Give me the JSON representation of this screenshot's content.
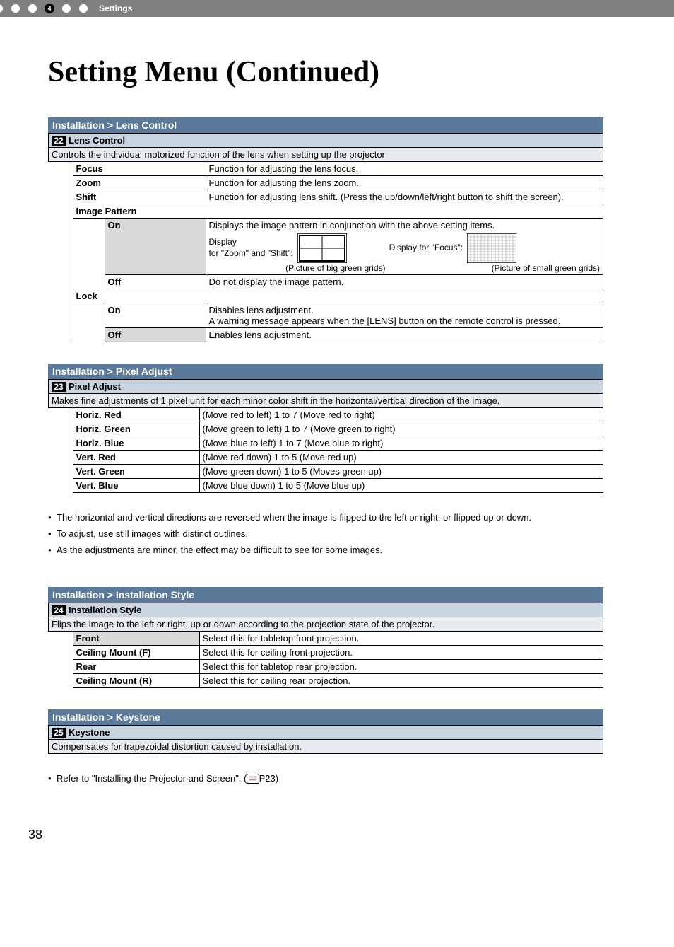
{
  "header": {
    "step_active": "4",
    "label": "Settings"
  },
  "page_title": "Setting Menu (Continued)",
  "page_number": "38",
  "sections": {
    "lens_control": {
      "breadcrumb": "Installation > Lens Control",
      "num": "22",
      "title": "Lens Control",
      "desc": "Controls the individual motorized function of the lens when setting up the projector",
      "rows": {
        "focus": {
          "name": "Focus",
          "value": "Function for adjusting the lens focus."
        },
        "zoom": {
          "name": "Zoom",
          "value": "Function for adjusting the lens zoom."
        },
        "shift": {
          "name": "Shift",
          "value": "Function for adjusting lens shift. (Press the up/down/left/right button to shift the screen)."
        }
      },
      "image_pattern": {
        "name": "Image Pattern",
        "on": {
          "name": "On",
          "desc": "Displays the image pattern in conjunction with the above setting items.",
          "label1": "Display\nfor \"Zoom\" and \"Shift\":",
          "label2": "Display for \"Focus\":",
          "caption1": "(Picture of big green grids)",
          "caption2": "(Picture of small green grids)"
        },
        "off": {
          "name": "Off",
          "value": "Do not display the image pattern."
        }
      },
      "lock": {
        "name": "Lock",
        "on": {
          "name": "On",
          "value": "Disables lens adjustment.\nA warning message appears when the [LENS] button on the remote control is pressed."
        },
        "off": {
          "name": "Off",
          "value": "Enables lens adjustment."
        }
      }
    },
    "pixel_adjust": {
      "breadcrumb": "Installation > Pixel Adjust",
      "num": "23",
      "title": "Pixel Adjust",
      "desc": "Makes fine adjustments of 1 pixel unit for each minor color shift in the horizontal/vertical direction of the image.",
      "rows": {
        "hr": {
          "name": "Horiz. Red",
          "value": "(Move red to left) 1 to 7 (Move red to right)"
        },
        "hg": {
          "name": "Horiz. Green",
          "value": "(Move green to left) 1 to 7 (Move green to right)"
        },
        "hb": {
          "name": "Horiz. Blue",
          "value": "(Move blue to left) 1 to 7 (Move blue to right)"
        },
        "vr": {
          "name": "Vert. Red",
          "value": "(Move red down) 1 to 5 (Move red up)"
        },
        "vg": {
          "name": "Vert. Green",
          "value": "(Move green down) 1 to 5 (Moves green up)"
        },
        "vb": {
          "name": "Vert. Blue",
          "value": "(Move blue down) 1 to 5 (Move blue up)"
        }
      },
      "notes": {
        "n1": "The horizontal and vertical directions are reversed when the image is flipped to the left or right, or flipped up or down.",
        "n2": "To adjust, use still images with distinct outlines.",
        "n3": "As the adjustments are minor, the effect may be difficult to see for some images."
      }
    },
    "install_style": {
      "breadcrumb": "Installation > Installation Style",
      "num": "24",
      "title": "Installation Style",
      "desc": "Flips the image to the left or right, up or down according to the projection state of the projector.",
      "rows": {
        "front": {
          "name": "Front",
          "value": "Select this for tabletop front projection."
        },
        "cf": {
          "name": "Ceiling Mount (F)",
          "value": "Select this for ceiling front projection."
        },
        "rear": {
          "name": "Rear",
          "value": "Select this for tabletop rear projection."
        },
        "cr": {
          "name": "Ceiling Mount (R)",
          "value": "Select this for ceiling rear projection."
        }
      }
    },
    "keystone": {
      "breadcrumb": "Installation > Keystone",
      "num": "25",
      "title": "Keystone",
      "desc": "Compensates for trapezoidal distortion caused by installation.",
      "note": "Refer to \"Installing the Projector and Screen\". (",
      "ref": "P23",
      "note_close": ")"
    }
  }
}
